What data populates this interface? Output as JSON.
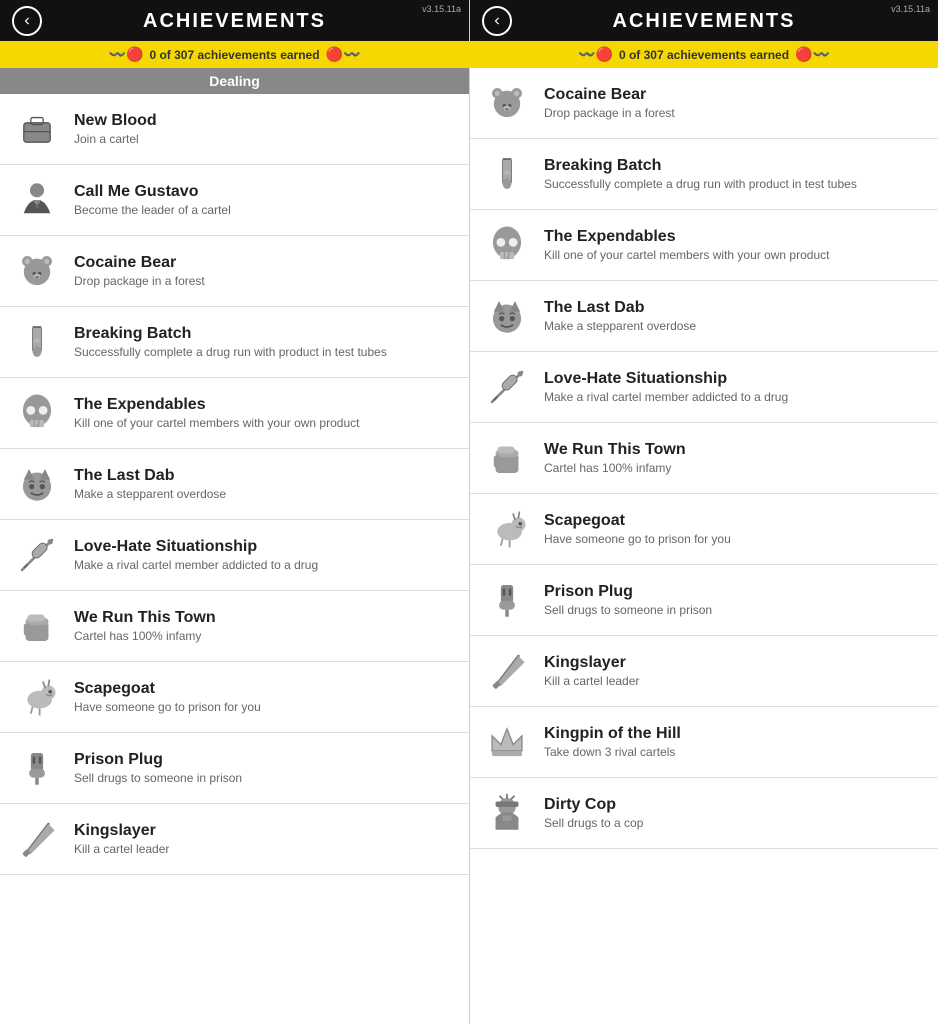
{
  "version": "v3.15.11a",
  "header": {
    "title": "ACHIEVEMENTS",
    "back_label": "back"
  },
  "banner": {
    "text": "0 of 307 achievements earned",
    "left_icon": "🐛",
    "right_icon": "🐛"
  },
  "category": "Dealing",
  "left_panel": {
    "achievements": [
      {
        "id": "new-blood",
        "name": "New Blood",
        "desc": "Join a cartel",
        "icon": "briefcase"
      },
      {
        "id": "call-me-gustavo",
        "name": "Call Me Gustavo",
        "desc": "Become the leader of a cartel",
        "icon": "person-suit"
      },
      {
        "id": "cocaine-bear",
        "name": "Cocaine Bear",
        "desc": "Drop package in a forest",
        "icon": "bear"
      },
      {
        "id": "breaking-batch",
        "name": "Breaking Batch",
        "desc": "Successfully complete a drug run with product in test tubes",
        "icon": "test-tube"
      },
      {
        "id": "the-expendables",
        "name": "The Expendables",
        "desc": "Kill one of your cartel members with your own product",
        "icon": "skull-face"
      },
      {
        "id": "the-last-dab",
        "name": "The Last Dab",
        "desc": "Make a stepparent overdose",
        "icon": "devil-face"
      },
      {
        "id": "love-hate",
        "name": "Love-Hate Situationship",
        "desc": "Make a rival cartel member addicted to a drug",
        "icon": "syringe"
      },
      {
        "id": "we-run-this-town",
        "name": "We Run This Town",
        "desc": "Cartel has 100% infamy",
        "icon": "fist"
      },
      {
        "id": "scapegoat",
        "name": "Scapegoat",
        "desc": "Have someone go to prison for you",
        "icon": "goat"
      },
      {
        "id": "prison-plug",
        "name": "Prison Plug",
        "desc": "Sell drugs to someone in prison",
        "icon": "plug"
      },
      {
        "id": "kingslayer",
        "name": "Kingslayer",
        "desc": "Kill a cartel leader",
        "icon": "knife"
      }
    ]
  },
  "right_panel": {
    "achievements": [
      {
        "id": "cocaine-bear-r",
        "name": "Cocaine Bear",
        "desc": "Drop package in a forest",
        "icon": "bear"
      },
      {
        "id": "breaking-batch-r",
        "name": "Breaking Batch",
        "desc": "Successfully complete a drug run with product in test tubes",
        "icon": "test-tube"
      },
      {
        "id": "the-expendables-r",
        "name": "The Expendables",
        "desc": "Kill one of your cartel members with your own product",
        "icon": "skull-face"
      },
      {
        "id": "the-last-dab-r",
        "name": "The Last Dab",
        "desc": "Make a stepparent overdose",
        "icon": "devil-face"
      },
      {
        "id": "love-hate-r",
        "name": "Love-Hate Situationship",
        "desc": "Make a rival cartel member addicted to a drug",
        "icon": "syringe"
      },
      {
        "id": "we-run-this-town-r",
        "name": "We Run This Town",
        "desc": "Cartel has 100% infamy",
        "icon": "fist"
      },
      {
        "id": "scapegoat-r",
        "name": "Scapegoat",
        "desc": "Have someone go to prison for you",
        "icon": "goat"
      },
      {
        "id": "prison-plug-r",
        "name": "Prison Plug",
        "desc": "Sell drugs to someone in prison",
        "icon": "plug"
      },
      {
        "id": "kingslayer-r",
        "name": "Kingslayer",
        "desc": "Kill a cartel leader",
        "icon": "knife"
      },
      {
        "id": "kingpin-of-the-hill",
        "name": "Kingpin of the Hill",
        "desc": "Take down 3 rival cartels",
        "icon": "crown"
      },
      {
        "id": "dirty-cop",
        "name": "Dirty Cop",
        "desc": "Sell drugs to a cop",
        "icon": "cop"
      }
    ]
  }
}
